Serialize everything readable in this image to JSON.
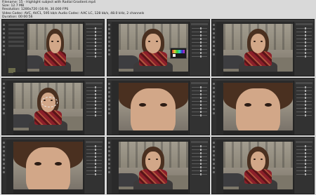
{
  "header": {
    "filename": "Filename: 15 - Highlight subject with Radial Gradient.mp4",
    "size": "Size: 12.7 MB",
    "resolution": "Resolution: 1280x720 (16:9), 30.000 FPS",
    "codec": "Video Codec: AVC, AVC1, 595 kb/s Audio Codec: AAC LC, 128 kb/s, 48.0 kHz, 2 channels",
    "duration": "Duration: 00:00:56"
  },
  "thumbnails": [
    {
      "variant": "portrait",
      "show_library": true,
      "selection": false,
      "popup": false
    },
    {
      "variant": "portrait",
      "show_library": false,
      "selection": false,
      "popup": true
    },
    {
      "variant": "portrait",
      "show_library": false,
      "selection": false,
      "popup": false
    },
    {
      "variant": "portrait",
      "show_library": false,
      "selection": true,
      "popup": false
    },
    {
      "variant": "closeup",
      "show_library": false,
      "selection": false,
      "popup": false
    },
    {
      "variant": "closeup",
      "show_library": false,
      "selection": false,
      "popup": false
    },
    {
      "variant": "closeup",
      "show_library": false,
      "selection": false,
      "popup": false
    },
    {
      "variant": "portrait",
      "show_library": false,
      "selection": false,
      "popup": false
    },
    {
      "variant": "portrait",
      "show_library": false,
      "selection": false,
      "popup": false
    }
  ],
  "colors": {
    "background": "#d9d9d9",
    "app_panel": "#323232",
    "scarf": "#8c1f2a"
  }
}
